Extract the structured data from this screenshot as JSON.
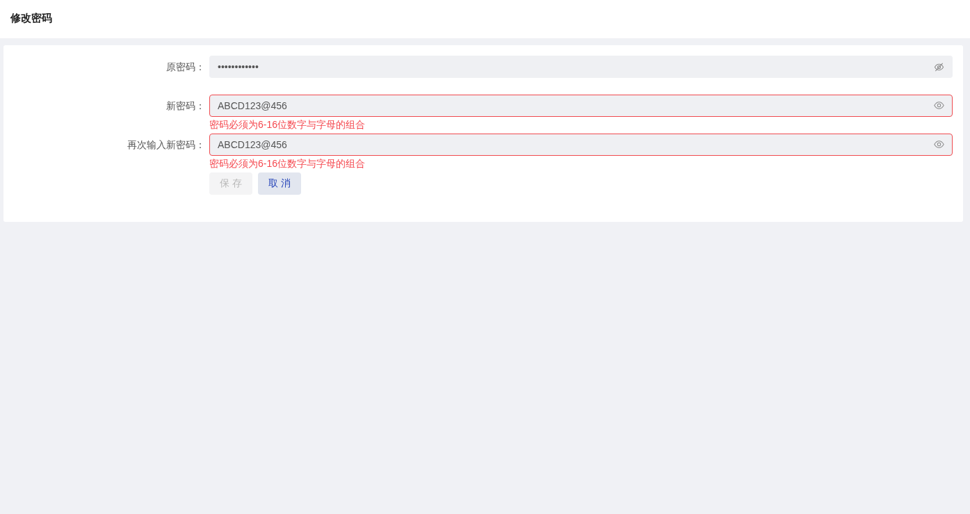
{
  "header": {
    "title": "修改密码"
  },
  "form": {
    "fields": [
      {
        "label": "原密码：",
        "value": "••••••••••••",
        "masked": true,
        "invalid": false
      },
      {
        "label": "新密码：",
        "value": "ABCD123@456",
        "masked": false,
        "invalid": true,
        "error": "密码必须为6-16位数字与字母的组合"
      },
      {
        "label": "再次输入新密码：",
        "value": "ABCD123@456",
        "masked": false,
        "invalid": true,
        "error": "密码必须为6-16位数字与字母的组合"
      }
    ],
    "buttons": [
      {
        "label": "保 存",
        "kind": "save",
        "disabled": true
      },
      {
        "label": "取 消",
        "kind": "cancel",
        "disabled": false
      }
    ]
  }
}
